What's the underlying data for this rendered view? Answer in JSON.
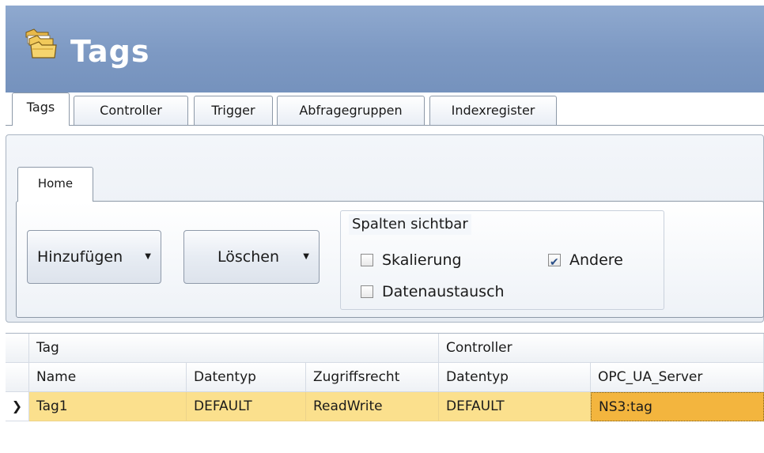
{
  "header": {
    "title": "Tags",
    "icon": "tags-folder-icon"
  },
  "tabs": [
    {
      "label": "Tags",
      "active": true
    },
    {
      "label": "Controller",
      "active": false
    },
    {
      "label": "Trigger",
      "active": false
    },
    {
      "label": "Abfragegruppen",
      "active": false
    },
    {
      "label": "Indexregister",
      "active": false
    }
  ],
  "ribbon": {
    "tab_label": "Home",
    "add_button": "Hinzufügen",
    "delete_button": "Löschen",
    "columns_group": {
      "title": "Spalten sichtbar",
      "options": [
        {
          "label": "Skalierung",
          "checked": false
        },
        {
          "label": "Andere",
          "checked": true
        },
        {
          "label": "Datenaustausch",
          "checked": false
        }
      ]
    }
  },
  "grid": {
    "group_headers": [
      "Tag",
      "Controller"
    ],
    "columns": [
      "Name",
      "Datentyp",
      "Zugriffsrecht",
      "Datentyp",
      "OPC_UA_Server"
    ],
    "rows": [
      {
        "selected": true,
        "cells": [
          "Tag1",
          "DEFAULT",
          "ReadWrite",
          "DEFAULT",
          "NS3:tag"
        ]
      }
    ]
  },
  "colors": {
    "header_bg": "#7d99c3",
    "selected_row": "#fbe08d",
    "current_cell": "#f3b53e"
  }
}
